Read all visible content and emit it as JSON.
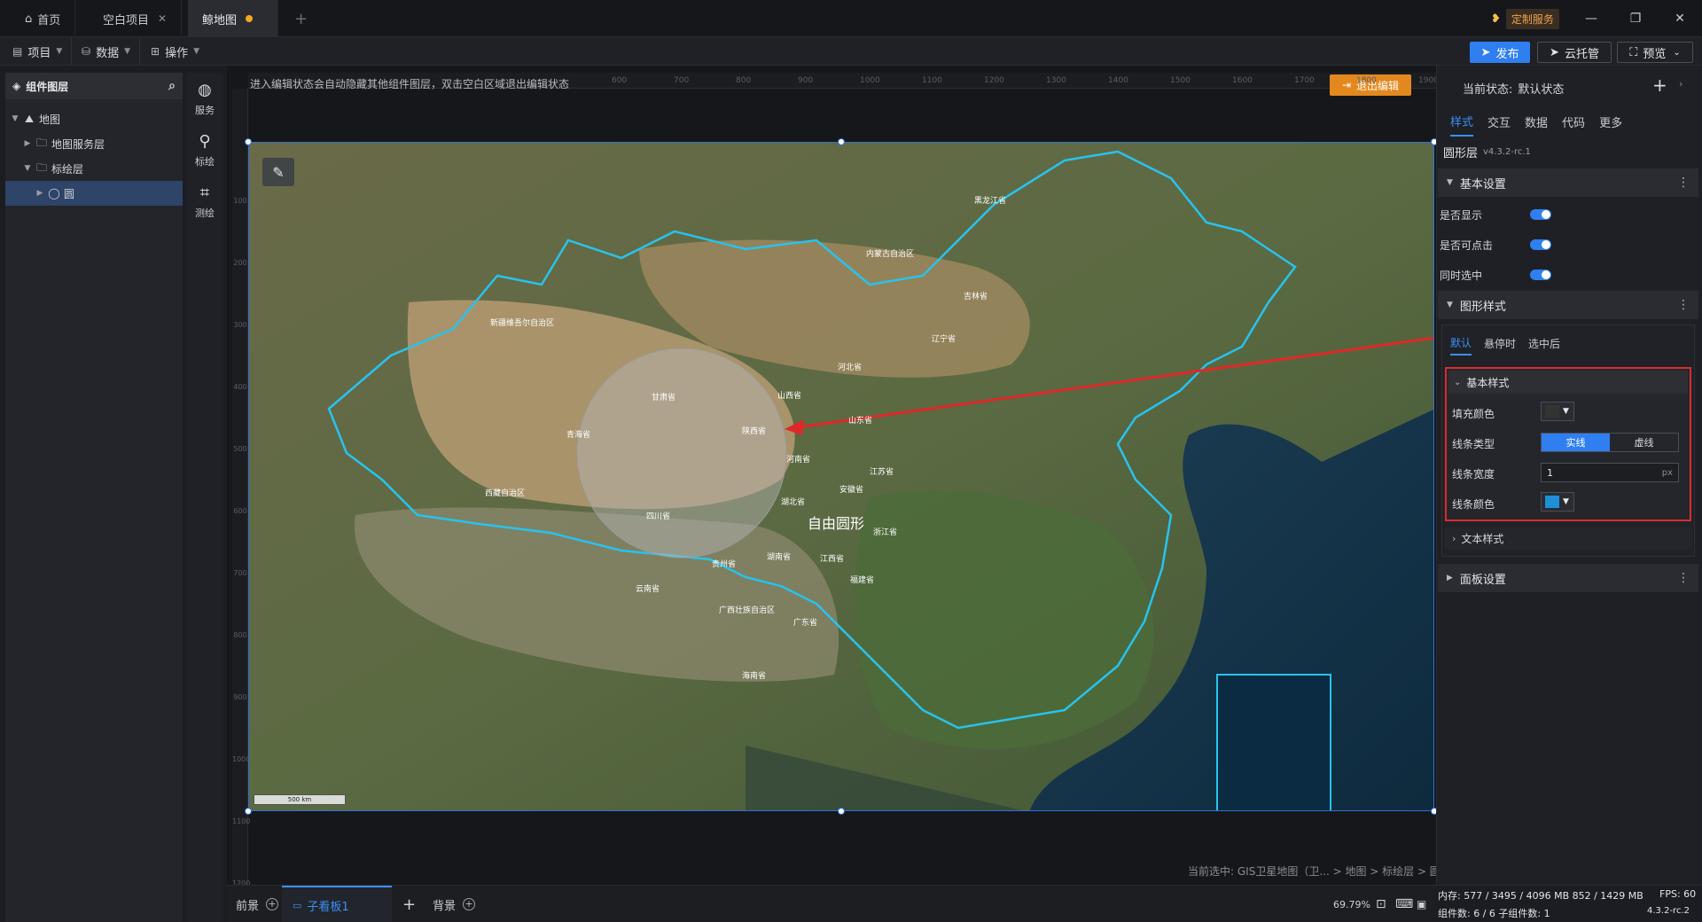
{
  "titlebar": {
    "tabs": [
      {
        "label": "首页",
        "icon": "home-icon"
      },
      {
        "label": "空白项目"
      },
      {
        "label": "鲸地图"
      }
    ],
    "new_tab": "+",
    "service_badge": "定制服务"
  },
  "toolbar": {
    "menus": [
      {
        "label": "项目"
      },
      {
        "label": "数据"
      },
      {
        "label": "操作"
      }
    ],
    "publish": "发布",
    "cloud": "云托管",
    "preview": "预览"
  },
  "layers": {
    "title": "组件图层",
    "items": [
      {
        "label": "地图"
      },
      {
        "label": "地图服务层"
      },
      {
        "label": "标绘层"
      },
      {
        "label": "圆"
      }
    ]
  },
  "strip": [
    {
      "label": "服务"
    },
    {
      "label": "标绘"
    },
    {
      "label": "测绘"
    }
  ],
  "canvas": {
    "notice": "进入编辑状态会自动隐藏其他组件图层，双击空白区域退出编辑状态",
    "exit_edit": "退出编辑",
    "ruler_top": [
      "600",
      "700",
      "800",
      "900",
      "1000",
      "1100",
      "1200",
      "1300",
      "1400",
      "1500",
      "1600",
      "1700",
      "1800",
      "1900"
    ],
    "ruler_left": [
      "100",
      "200",
      "300",
      "400",
      "500",
      "600",
      "700",
      "800",
      "900",
      "1000",
      "1100",
      "1200"
    ],
    "scale_label": "500 km",
    "circle_label": "自由圆形",
    "selection_path": "当前选中: GIS卫星地图（卫... > 地图 > 标绘层 > 圆"
  },
  "map_labels": {
    "heilongjiang": "黑龙江省",
    "neimenggu": "内蒙古自治区",
    "jilin": "吉林省",
    "liaoning": "辽宁省",
    "xinjiang": "新疆维吾尔自治区",
    "gansu": "甘肃省",
    "hebei": "河北省",
    "shanxi": "山西省",
    "shandong": "山东省",
    "qinghai": "青海省",
    "shaanxi": "陕西省",
    "henan": "河南省",
    "jiangsu": "江苏省",
    "xizang": "西藏自治区",
    "anhui": "安徽省",
    "hubei": "湖北省",
    "sichuan": "四川省",
    "zhejiang": "浙江省",
    "guizhou": "贵州省",
    "hunan": "湖南省",
    "jiangxi": "江西省",
    "fujian": "福建省",
    "yunnan": "云南省",
    "guangxi": "广西壮族自治区",
    "guangdong": "广东省",
    "hainan": "海南省"
  },
  "bottom": {
    "front": "前景",
    "subboard": "子看板1",
    "add": "+",
    "background": "背景",
    "zoom": "69.79%"
  },
  "panel": {
    "state_label": "当前状态:",
    "state_value": "默认状态",
    "add": "+",
    "tabs": [
      "样式",
      "交互",
      "数据",
      "代码",
      "更多"
    ],
    "layer_name": "圆形层",
    "version": "v4.3.2-rc.1",
    "basic_settings": "基本设置",
    "show": "是否显示",
    "clickable": "是否可点击",
    "select_sync": "同时选中",
    "shape_style": "图形样式",
    "states": [
      "默认",
      "悬停时",
      "选中后"
    ],
    "basic_style": "基本样式",
    "fill_color": "填充颜色",
    "line_type": "线条类型",
    "solid": "实线",
    "dashed": "虚线",
    "line_width": "线条宽度",
    "line_width_value": "1",
    "unit": "px",
    "line_color": "线条颜色",
    "text_style": "文本样式",
    "panel_settings": "面板设置",
    "colors": {
      "fill": "#333333",
      "line": "#1f8fd8"
    }
  },
  "status": {
    "memory": "内存: 577 / 3495 / 4096 MB  852 / 1429 MB",
    "fps": "FPS: 60",
    "components": "组件数: 6 / 6  子组件数: 1",
    "version": "4.3.2-rc.2"
  }
}
